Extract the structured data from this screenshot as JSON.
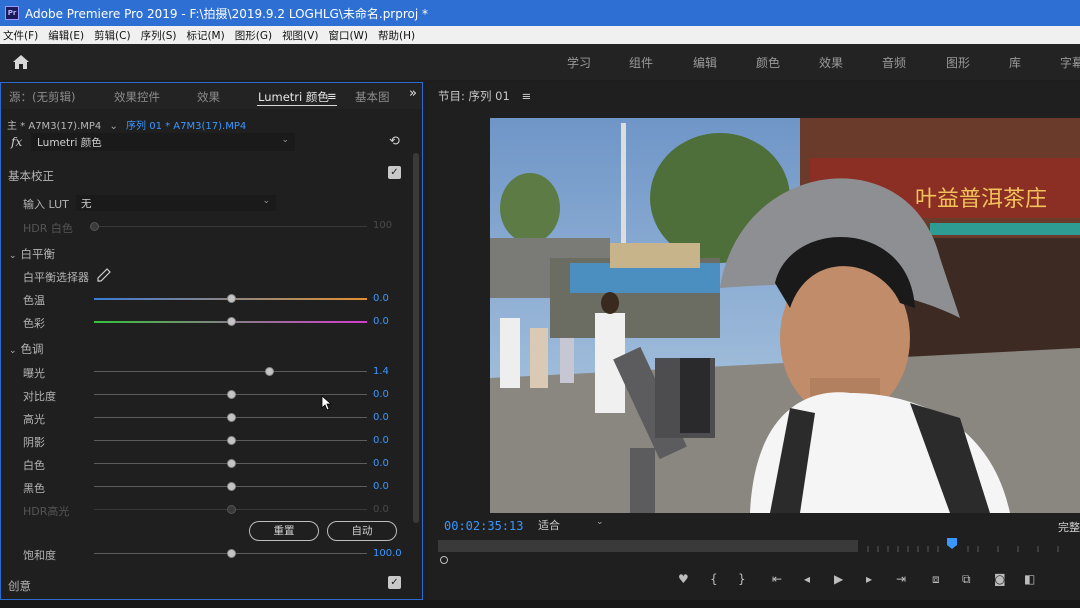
{
  "window": {
    "title": "Adobe Premiere Pro 2019 - F:\\拍摄\\2019.9.2 LOGHLG\\未命名.prproj *",
    "logo": "Pr"
  },
  "menu": [
    "文件(F)",
    "编辑(E)",
    "剪辑(C)",
    "序列(S)",
    "标记(M)",
    "图形(G)",
    "视图(V)",
    "窗口(W)",
    "帮助(H)"
  ],
  "workspaces": [
    "学习",
    "组件",
    "编辑",
    "颜色",
    "效果",
    "音频",
    "图形",
    "库",
    "字幕"
  ],
  "left_panel": {
    "tabs": [
      "源：(无剪辑)",
      "效果控件",
      "效果",
      "Lumetri 颜色",
      "基本图"
    ],
    "active_tab": "Lumetri 颜色",
    "tab_menu_icon": "≡",
    "tab_overflow_icon": "»",
    "source_master": "主 * A7M3(17).MP4",
    "source_sequence": "序列 01 * A7M3(17).MP4",
    "fx_label": "fx",
    "fx_effect": "Lumetri 颜色",
    "basic_correction": {
      "title": "基本校正",
      "input_lut_label": "输入 LUT",
      "input_lut_value": "无",
      "hdr_white_label": "HDR 白色",
      "hdr_white_value": "100",
      "white_balance": {
        "title": "白平衡",
        "selector_label": "白平衡选择器",
        "temperature_label": "色温",
        "temperature_value": "0.0",
        "tint_label": "色彩",
        "tint_value": "0.0"
      },
      "tone": {
        "title": "色调",
        "exposure_label": "曝光",
        "exposure_value": "1.4",
        "contrast_label": "对比度",
        "contrast_value": "0.0",
        "highlights_label": "高光",
        "highlights_value": "0.0",
        "shadows_label": "阴影",
        "shadows_value": "0.0",
        "whites_label": "白色",
        "whites_value": "0.0",
        "blacks_label": "黑色",
        "blacks_value": "0.0",
        "hdr_highlights_label": "HDR高光",
        "hdr_highlights_value": "0.0"
      },
      "reset_button": "重置",
      "auto_button": "自动",
      "saturation_label": "饱和度",
      "saturation_value": "100.0"
    },
    "creative_title": "创意"
  },
  "program_monitor": {
    "title": "节目: 序列 01",
    "menu_icon": "≡",
    "timecode": "00:02:35:13",
    "fit": "适合",
    "quality": "完整",
    "shop_sign": "叶益普洱茶庄"
  }
}
